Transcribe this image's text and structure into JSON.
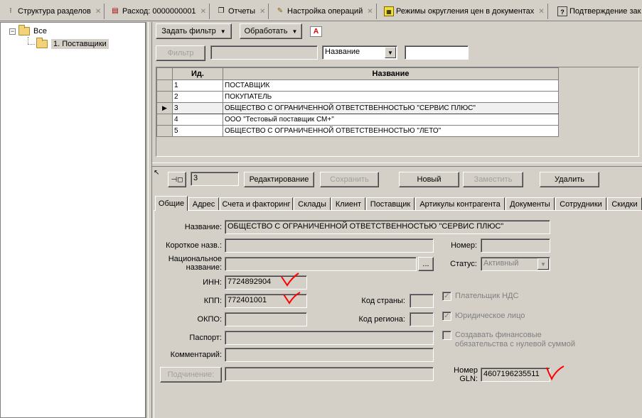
{
  "doc_tabs": [
    {
      "label": "Структура разделов",
      "icon": "dots-icon"
    },
    {
      "label": "Расход: 0000000001",
      "icon": "document-icon"
    },
    {
      "label": "Отчеты",
      "icon": "pages-icon"
    },
    {
      "label": "Настройка операций",
      "icon": "wand-icon"
    },
    {
      "label": "Режимы округления цен в документах",
      "icon": "calculator-icon"
    },
    {
      "label": "Подтверждение зак",
      "icon": "question-doc-icon"
    }
  ],
  "tree": {
    "root": "Все",
    "child": "1. Поставщики"
  },
  "toolbar": {
    "filter_button": "Задать фильтр",
    "process_button": "Обработать",
    "filter_label": "Фильтр",
    "filter_field_value": "",
    "filter_column": "Название",
    "filter_text": ""
  },
  "grid": {
    "columns": [
      "Ид.",
      "Название"
    ],
    "rows": [
      {
        "id": "1",
        "name": "ПОСТАВЩИК"
      },
      {
        "id": "2",
        "name": "ПОКУПАТЕЛЬ"
      },
      {
        "id": "3",
        "name": "ОБЩЕСТВО С ОГРАНИЧЕННОЙ ОТВЕТСТВЕННОСТЬЮ \"СЕРВИС ПЛЮС\""
      },
      {
        "id": "4",
        "name": "ООО \"Тестовый поставщик СМ+\""
      },
      {
        "id": "5",
        "name": "ОБЩЕСТВО С ОГРАНИЧЕННОЙ ОТВЕТСТВЕННОСТЬЮ \"ЛЕТО\""
      }
    ],
    "current_row_index": 2
  },
  "record": {
    "current_id": "3",
    "edit_button": "Редактирование",
    "save_button": "Сохранить",
    "new_button": "Новый",
    "replace_button": "Заместить",
    "delete_button": "Удалить"
  },
  "detail_tabs": [
    "Общие",
    "Адрес",
    "Счета и факторинг",
    "Склады",
    "Клиент",
    "Поставщик",
    "Артикулы контрагента",
    "Документы",
    "Сотрудники",
    "Скидки"
  ],
  "form": {
    "name_label": "Название:",
    "name_value": "ОБЩЕСТВО С ОГРАНИЧЕННОЙ ОТВЕТСТВЕННОСТЬЮ \"СЕРВИС ПЛЮС\"",
    "short_name_label": "Короткое назв.:",
    "short_name_value": "",
    "number_label": "Номер:",
    "number_value": "",
    "national_name_label_1": "Национальное",
    "national_name_label_2": "название:",
    "national_name_value": "",
    "ellipsis": "...",
    "status_label": "Статус:",
    "status_value": "Активный",
    "inn_label": "ИНН:",
    "inn_value": "7724892904",
    "kpp_label": "КПП:",
    "kpp_value": "772401001",
    "country_code_label": "Код страны:",
    "country_code_value": "",
    "okpo_label": "ОКПО:",
    "okpo_value": "",
    "region_code_label": "Код региона:",
    "region_code_value": "",
    "passport_label": "Паспорт:",
    "passport_value": "",
    "comment_label": "Комментарий:",
    "comment_value": "",
    "subordination_button": "Подчинение:",
    "subordination_value": "",
    "vat_payer_label": "Плательщик НДС",
    "vat_payer_checked": true,
    "legal_entity_label": "Юридическое лицо",
    "legal_entity_checked": true,
    "zero_obligations_label_1": "Создавать финансовые",
    "zero_obligations_label_2": "обязательства с нулевой суммой",
    "zero_obligations_checked": false,
    "gln_label_1": "Номер",
    "gln_label_2": "GLN:",
    "gln_value": "4607196235511"
  },
  "colors": {
    "window_bg": "#d4d0c8",
    "annotation": "#ff0000",
    "folder": "#f2d27a"
  }
}
